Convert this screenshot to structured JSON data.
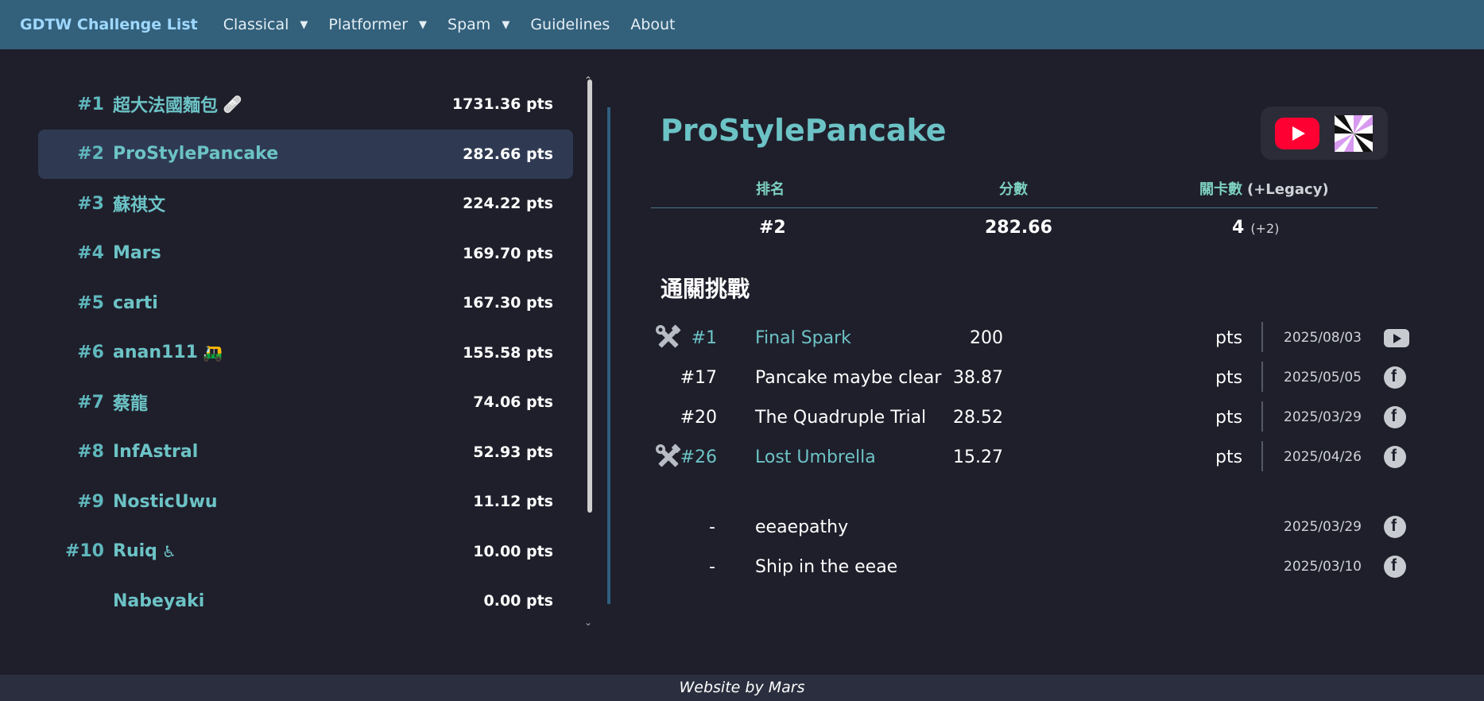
{
  "nav": {
    "brand": "GDTW Challenge List",
    "items": [
      {
        "label": "Classical",
        "dropdown": true
      },
      {
        "label": "Platformer",
        "dropdown": true
      },
      {
        "label": "Spam",
        "dropdown": true
      },
      {
        "label": "Guidelines",
        "dropdown": false
      },
      {
        "label": "About",
        "dropdown": false
      }
    ]
  },
  "players": [
    {
      "rank": "#1",
      "name": "超大法國麵包",
      "emoji": "🩹",
      "points": "1731.36 pts"
    },
    {
      "rank": "#2",
      "name": "ProStylePancake",
      "emoji": "",
      "points": "282.66 pts"
    },
    {
      "rank": "#3",
      "name": "蘇祺文",
      "emoji": "",
      "points": "224.22 pts"
    },
    {
      "rank": "#4",
      "name": "Mars",
      "emoji": "",
      "points": "169.70 pts"
    },
    {
      "rank": "#5",
      "name": "carti",
      "emoji": "",
      "points": "167.30 pts"
    },
    {
      "rank": "#6",
      "name": "anan111",
      "emoji": "🛺",
      "points": "155.58 pts"
    },
    {
      "rank": "#7",
      "name": "蔡龍",
      "emoji": "",
      "points": "74.06 pts"
    },
    {
      "rank": "#8",
      "name": "InfAstral",
      "emoji": "",
      "points": "52.93 pts"
    },
    {
      "rank": "#9",
      "name": "NosticUwu",
      "emoji": "",
      "points": "11.12 pts"
    },
    {
      "rank": "#10",
      "name": "Ruiq",
      "emoji": "♿",
      "points": "10.00 pts"
    },
    {
      "rank": "",
      "name": "Nabeyaki",
      "emoji": "",
      "points": "0.00 pts"
    }
  ],
  "selected_player": "ProStylePancake",
  "detail": {
    "name": "ProStylePancake",
    "stats_headers": {
      "rank": "排名",
      "score": "分數",
      "levels": "關卡數",
      "levels_legacy": "(+Legacy)"
    },
    "stats_values": {
      "rank": "#2",
      "score": "282.66",
      "levels": "4",
      "levels_legacy": "(+2)"
    },
    "section_title": "通關挑戰",
    "completions": [
      {
        "tool": true,
        "rank": "#1",
        "name": "Final Spark",
        "points": "200",
        "unit": "pts",
        "date": "2025/08/03",
        "icon": "youtube-icon",
        "teal": true
      },
      {
        "tool": false,
        "rank": "#17",
        "name": "Pancake maybe clear",
        "points": "38.87",
        "unit": "pts",
        "date": "2025/05/05",
        "icon": "facebook-icon",
        "teal": false
      },
      {
        "tool": false,
        "rank": "#20",
        "name": "The Quadruple Trial",
        "points": "28.52",
        "unit": "pts",
        "date": "2025/03/29",
        "icon": "facebook-icon",
        "teal": false
      },
      {
        "tool": true,
        "rank": "#26",
        "name": "Lost Umbrella",
        "points": "15.27",
        "unit": "pts",
        "date": "2025/04/26",
        "icon": "facebook-icon",
        "teal": true
      }
    ],
    "legacy": [
      {
        "rank": "-",
        "name": "eeaepathy",
        "date": "2025/03/29",
        "icon": "facebook-icon"
      },
      {
        "rank": "-",
        "name": "Ship in the eeae",
        "date": "2025/03/10",
        "icon": "facebook-icon"
      }
    ]
  },
  "footer": "Website by Mars",
  "colors": {
    "navbar": "#33607b",
    "background": "#1f1f2b",
    "accent": "#6cc3c6",
    "selected_row": "#2f3a52",
    "youtube": "#ff0033"
  }
}
